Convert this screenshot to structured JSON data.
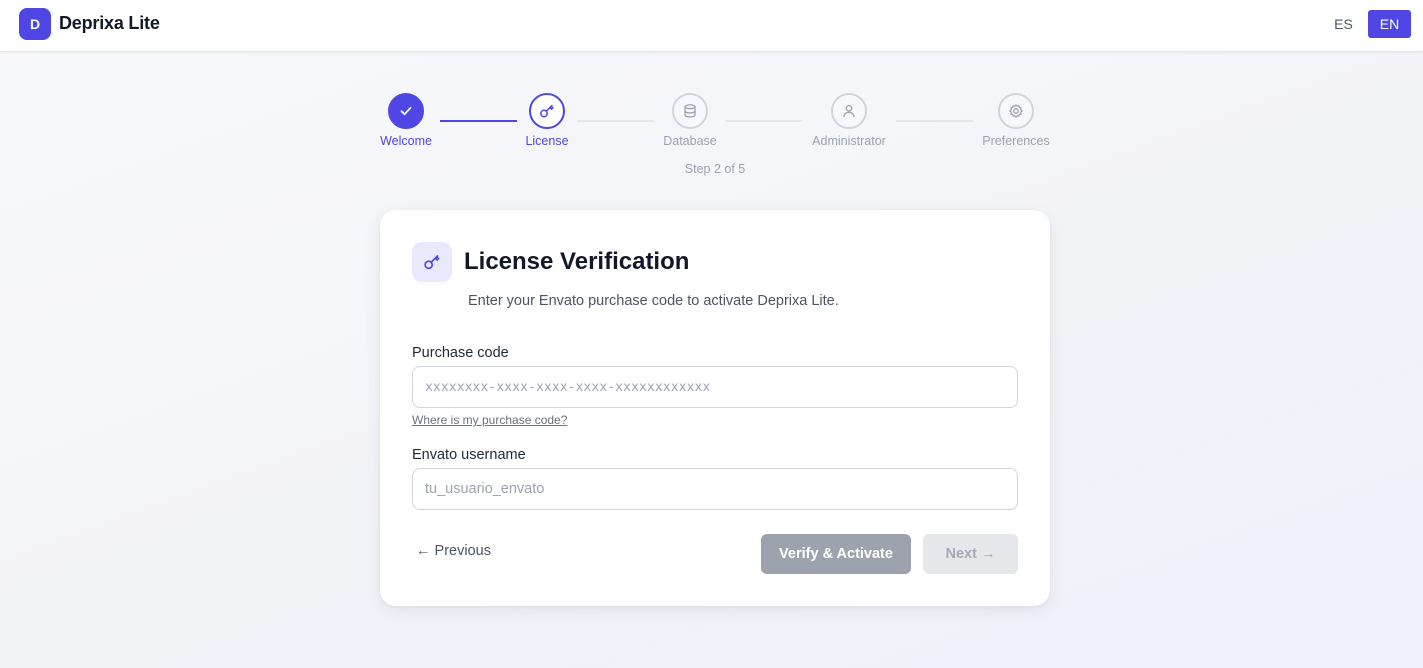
{
  "app": {
    "logo_letter": "D",
    "name": "Deprixa Lite",
    "accent_color": "#4f46e5"
  },
  "languages": [
    {
      "label": "ES",
      "selected": false
    },
    {
      "label": "EN",
      "selected": true
    }
  ],
  "stepper": {
    "steps": [
      {
        "label": "Welcome",
        "status": "done",
        "icon": "check-icon"
      },
      {
        "label": "License",
        "status": "active",
        "icon": "key-icon"
      },
      {
        "label": "Database",
        "status": "pending",
        "icon": "database-icon"
      },
      {
        "label": "Administrator",
        "status": "pending",
        "icon": "user-icon"
      },
      {
        "label": "Preferences",
        "status": "pending",
        "icon": "gear-icon"
      }
    ],
    "counter": "Step 2 of 5"
  },
  "card": {
    "icon": "key-icon",
    "title": "License Verification",
    "subtitle": "Enter your Envato purchase code to activate Deprixa Lite.",
    "purchase_code": {
      "label": "Purchase code",
      "placeholder": "xxxxxxxx-xxxx-xxxx-xxxx-xxxxxxxxxxxx",
      "value": ""
    },
    "help_link": "Where is my purchase code?",
    "username": {
      "label": "Envato username",
      "placeholder": "tu_usuario_envato",
      "value": ""
    },
    "previous_label": "← Previous",
    "verify_label": "Verify & Activate",
    "next_label": "Next →"
  }
}
